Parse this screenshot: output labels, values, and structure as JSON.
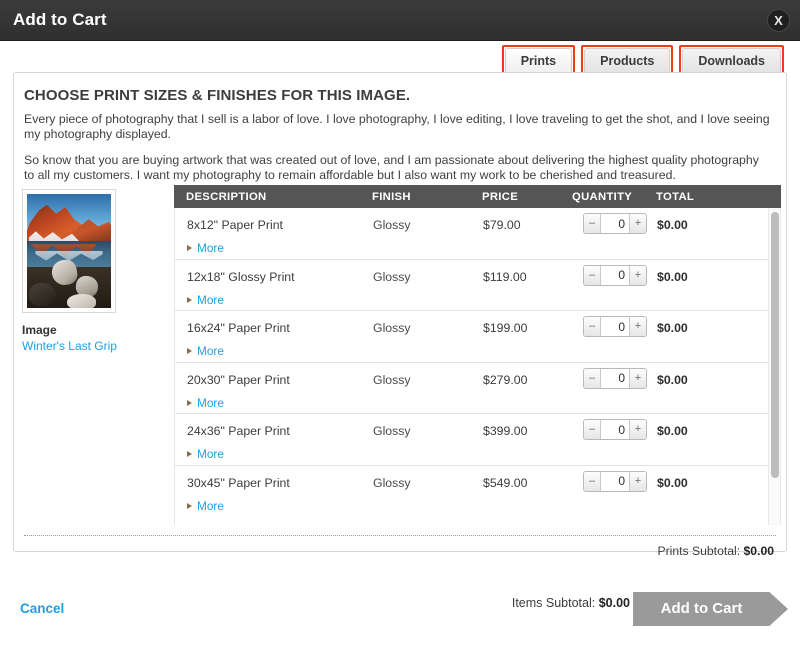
{
  "window": {
    "title": "Add to Cart",
    "close_label": "X"
  },
  "tabs": [
    {
      "label": "Prints",
      "active": true
    },
    {
      "label": "Products",
      "active": false
    },
    {
      "label": "Downloads",
      "active": false
    }
  ],
  "main": {
    "heading": "CHOOSE PRINT SIZES & FINISHES FOR THIS IMAGE.",
    "paragraph1": "Every piece of photography that I sell is a labor of love. I love photography, I love editing, I love traveling to get the shot, and I love seeing my photography displayed.",
    "paragraph2": "So know that you are buying artwork that was created out of love, and I am passionate about delivering the highest quality photography to all my customers. I want my photography to remain affordable but I also want my work to be cherished and treasured."
  },
  "image_panel": {
    "label": "Image",
    "title": "Winter's Last Grip"
  },
  "table": {
    "columns": [
      "DESCRIPTION",
      "FINISH",
      "PRICE",
      "QUANTITY",
      "TOTAL"
    ],
    "more_label": "More",
    "rows": [
      {
        "description": "8x12\" Paper Print",
        "finish": "Glossy",
        "price": "$79.00",
        "quantity": "0",
        "total": "$0.00"
      },
      {
        "description": "12x18\" Glossy Print",
        "finish": "Glossy",
        "price": "$119.00",
        "quantity": "0",
        "total": "$0.00"
      },
      {
        "description": "16x24\" Paper Print",
        "finish": "Glossy",
        "price": "$199.00",
        "quantity": "0",
        "total": "$0.00"
      },
      {
        "description": "20x30\" Paper Print",
        "finish": "Glossy",
        "price": "$279.00",
        "quantity": "0",
        "total": "$0.00"
      },
      {
        "description": "24x36\" Paper Print",
        "finish": "Glossy",
        "price": "$399.00",
        "quantity": "0",
        "total": "$0.00"
      },
      {
        "description": "30x45\" Paper Print",
        "finish": "Glossy",
        "price": "$549.00",
        "quantity": "0",
        "total": "$0.00"
      }
    ],
    "stepper": {
      "minus": "–",
      "plus": "+"
    }
  },
  "totals": {
    "prints_subtotal_label": "Prints Subtotal:",
    "prints_subtotal_value": "$0.00",
    "items_subtotal_label": "Items Subtotal:",
    "items_subtotal_value": "$0.00"
  },
  "footer": {
    "cancel_label": "Cancel",
    "add_to_cart_label": "Add to Cart"
  },
  "colors": {
    "titlebar": "#333333",
    "tab_highlight": "#ef3b16",
    "link": "#1f9fe0",
    "table_header": "#555555",
    "add_button": "#9a9a9a"
  }
}
